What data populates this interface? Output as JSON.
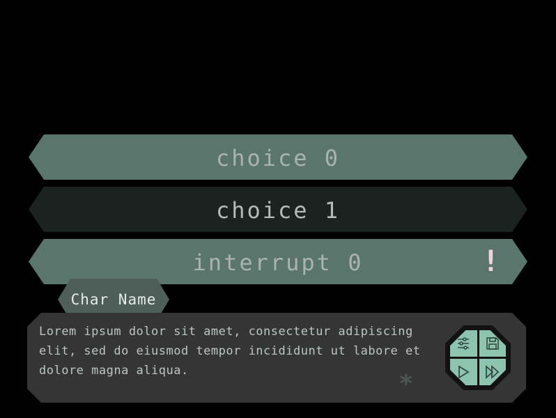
{
  "choices": [
    {
      "label": "choice 0"
    },
    {
      "label": "choice 1"
    },
    {
      "label": "interrupt 0",
      "marker": "!"
    }
  ],
  "dialogue": {
    "speaker": "Char Name",
    "text": "Lorem ipsum dolor sit amet, consectetur adipiscing\nelit, sed do eiusmod tempor incididunt ut labore et\ndolore magna aliqua.",
    "indicator": "*"
  },
  "controls": [
    {
      "icon": "sliders-icon"
    },
    {
      "icon": "save-icon"
    },
    {
      "icon": "play-icon"
    },
    {
      "icon": "fast-forward-icon"
    }
  ],
  "colors": {
    "choice_light": "#5a756b",
    "choice_dark": "#1b2320",
    "namebox": "#4d5f58",
    "textbox": "#353535",
    "control_button": "#8cc4b0",
    "interrupt_marker": "#ead6d6"
  }
}
